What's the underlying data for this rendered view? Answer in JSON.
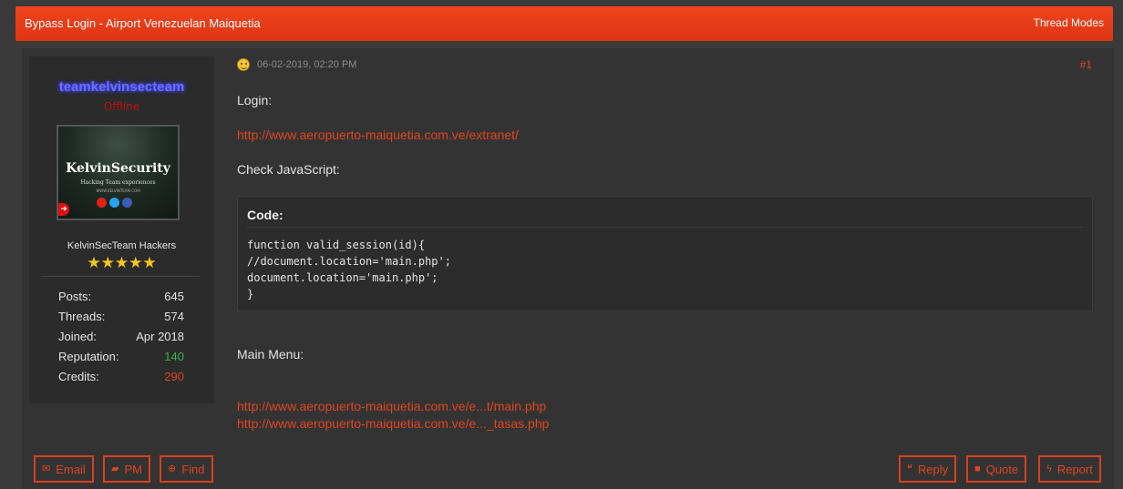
{
  "thread": {
    "title": "Bypass Login - Airport Venezuelan Maiquetia",
    "modes_label": "Thread Modes"
  },
  "author": {
    "username": "teamkelvinsecteam",
    "status": "Offline",
    "avatar": {
      "title": "KelvinSecurity",
      "subtitle": "Hacking Team experiences",
      "url": "WWW.KELVINTEAM.COM"
    },
    "usergroup": "KelvinSecTeam Hackers",
    "stars": "★★★★★",
    "stats": [
      {
        "label": "Posts:",
        "value": "645",
        "color": "#e4e4e4"
      },
      {
        "label": "Threads:",
        "value": "574",
        "color": "#e4e4e4"
      },
      {
        "label": "Joined:",
        "value": "Apr 2018",
        "color": "#e4e4e4"
      },
      {
        "label": "Reputation:",
        "value": "140",
        "color": "#39b54a"
      },
      {
        "label": "Credits:",
        "value": "290",
        "color": "#e0451f"
      }
    ]
  },
  "post": {
    "date": "06-02-2019, 02:20 PM",
    "number": "#1",
    "login_label": "Login:",
    "login_url": "http://www.aeropuerto-maiquetia.com.ve/extranet/",
    "check_js": "Check JavaScript:",
    "code_title": "Code:",
    "code": "function valid_session(id){\n//document.location='main.php';\ndocument.location='main.php';\n}",
    "main_menu": "Main Menu:",
    "links": [
      "http://www.aeropuerto-maiquetia.com.ve/e...t/main.php",
      "http://www.aeropuerto-maiquetia.com.ve/e..._tasas.php"
    ]
  },
  "buttons": {
    "email": "Email",
    "pm": "PM",
    "find": "Find",
    "reply": "Reply",
    "quote": "Quote",
    "report": "Report"
  },
  "colors": {
    "accent": "#e0451f",
    "header": "#e63b17",
    "background": "#3a3a3a",
    "username": "#6a6dff",
    "offline": "#c11010",
    "stars": "#f4c51c"
  }
}
